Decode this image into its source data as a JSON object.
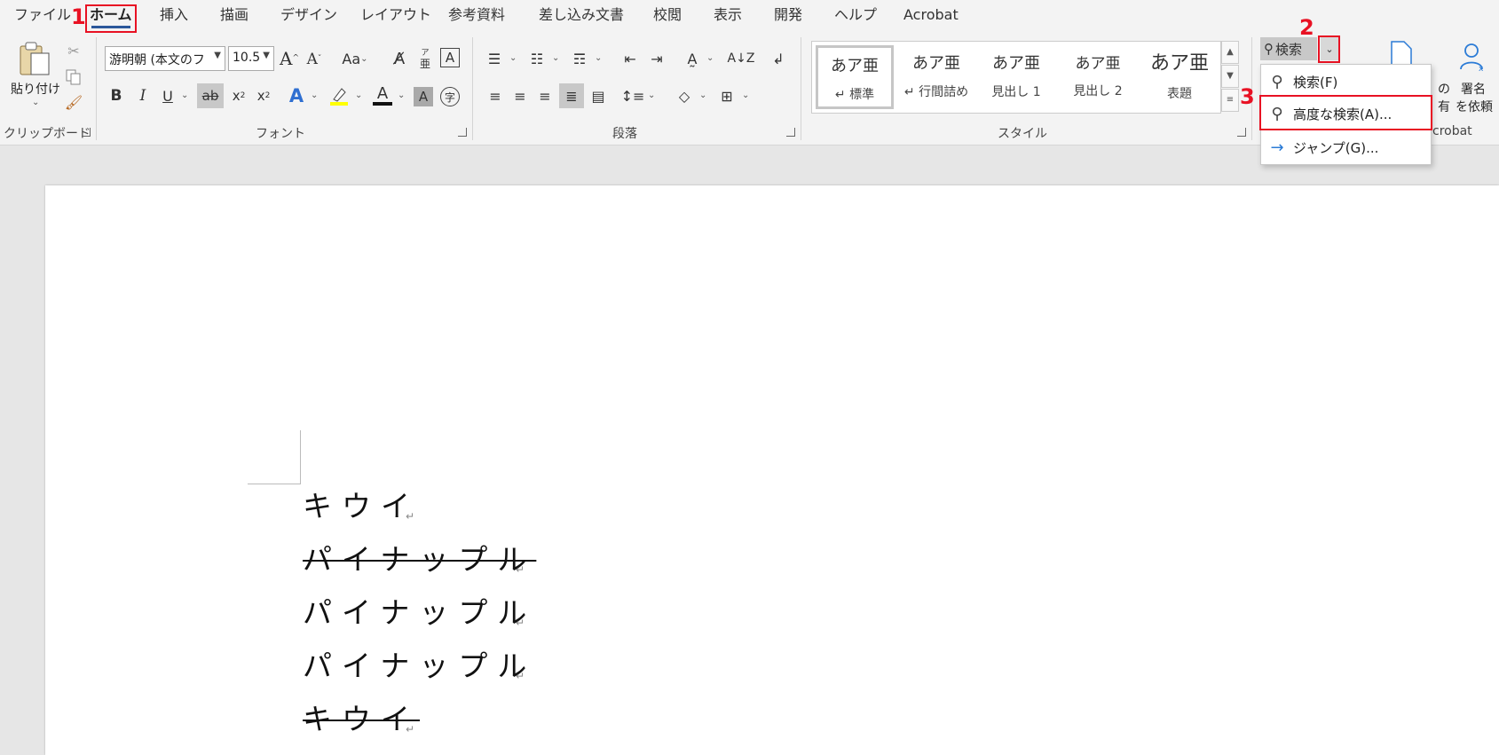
{
  "tabs": [
    {
      "label": "ファイル",
      "active": false
    },
    {
      "label": "ホーム",
      "active": true
    },
    {
      "label": "挿入",
      "active": false
    },
    {
      "label": "描画",
      "active": false
    },
    {
      "label": "デザイン",
      "active": false
    },
    {
      "label": "レイアウト",
      "active": false
    },
    {
      "label": "参考資料",
      "active": false
    },
    {
      "label": "差し込み文書",
      "active": false
    },
    {
      "label": "校閲",
      "active": false
    },
    {
      "label": "表示",
      "active": false
    },
    {
      "label": "開発",
      "active": false
    },
    {
      "label": "ヘルプ",
      "active": false
    },
    {
      "label": "Acrobat",
      "active": false
    }
  ],
  "annotations": {
    "step1": "1",
    "step2": "2",
    "step3": "3",
    "color": "#e81123"
  },
  "ribbon": {
    "clipboard": {
      "paste_label": "貼り付け",
      "group_label": "クリップボード"
    },
    "font": {
      "font_name": "游明朝 (本文のフ",
      "font_size": "10.5",
      "group_label": "フォント",
      "change_case": "Aa"
    },
    "paragraph": {
      "group_label": "段落"
    },
    "styles": {
      "group_label": "スタイル",
      "items": [
        {
          "sample": "あア亜",
          "name": "↵ 標準"
        },
        {
          "sample": "あア亜",
          "name": "↵ 行間詰め"
        },
        {
          "sample": "あア亜",
          "name": "見出し 1"
        },
        {
          "sample": "あア亜",
          "name": "見出し 2"
        },
        {
          "sample": "あア亜",
          "name": "表題"
        }
      ]
    },
    "editing": {
      "find_label": "検索"
    },
    "share": {
      "label_line1": "の",
      "label_line2": "有"
    },
    "acrobat": {
      "sign_line1": "署名",
      "sign_line2": "を依頼",
      "group_label": "crobat"
    }
  },
  "find_menu": {
    "items": [
      {
        "icon": "search-icon",
        "label": "検索(F)"
      },
      {
        "icon": "search-icon",
        "label": "高度な検索(A)..."
      },
      {
        "icon": "arrow-right-icon",
        "label": "ジャンプ(G)..."
      }
    ]
  },
  "document": {
    "lines": [
      {
        "text": "キウイ",
        "strike": false
      },
      {
        "text": "パイナップル",
        "strike": true
      },
      {
        "text": "パイナップル",
        "strike": false
      },
      {
        "text": "パイナップル",
        "strike": false
      },
      {
        "text": "キウイ",
        "strike": true
      }
    ],
    "paragraph_mark": "↵"
  }
}
